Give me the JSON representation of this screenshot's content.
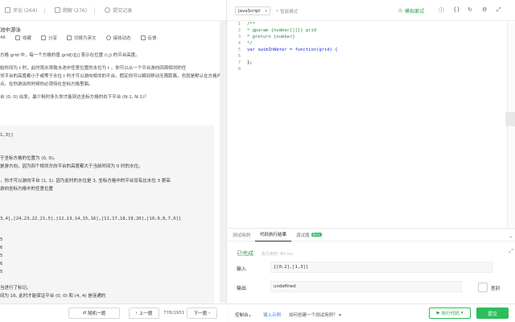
{
  "left": {
    "tabs": [
      {
        "label": "评论 (264)"
      },
      {
        "label": "题解 (276)"
      },
      {
        "label": "提交记录"
      }
    ],
    "title": "池中游泳",
    "actions": [
      {
        "label": "46"
      },
      {
        "label": "收藏"
      },
      {
        "label": "分享"
      },
      {
        "label": "切换为英文"
      },
      {
        "label": "接收动态"
      },
      {
        "label": "反馈"
      }
    ],
    "paragraphs": [
      "方格 grid 中，每一个方格的值 grid[i][j] 表示在位置 (i,j) 的平台高度。",
      "始时间为 t 时，此时雨水导致水池中任意位置的水位为 t 。你可以从一个平台游向四周相邻的任",
      "邻平台的高度都小于或等于水位 t 时才可以游向相邻的平台。假定你可以瞬间移动无限距离，也就是默认在方格内部游",
      "点。在你游泳的时候你必须待在坐标方格里面。",
      "台 (0, 0) 出发。最少耗时多久你才能到达坐标方格的右下平台 (N-1, N-1)？"
    ],
    "example1": [
      "1,3]]",
      "于坐标方格的位置为 (0, 0)。",
      "是游方向，因为四个相邻方向平台的高度都大于当前时间为 0 时的水位。",
      "，你才可以游向平台 (1, 1). 因为此时的水位是 3, 坐标方格中的平台没有比水位 3 更高",
      "游向坐标方格中的任意位置"
    ],
    "example2": [
      "3,4],[24,23,22,21,5],[12,13,14,15,16],[11,17,18,19,20],[10,9,8,7,6]]",
      "5",
      "6",
      "5",
      "6",
      "5",
      "当进行了标记。",
      "间为 16, 此时才能保证平台 (0, 0) 和 (4, 4) 是连通的"
    ],
    "bottom": {
      "random_label": "随机一题",
      "prev_label": "上一题",
      "page": "778/1951",
      "next_label": "下一题"
    }
  },
  "editor": {
    "language": "JavaScript",
    "smart_mode": "智能模式",
    "sim_test": "模拟面试",
    "line_numbers": [
      "1",
      "2",
      "3",
      "4",
      "5",
      "6",
      "7",
      "8"
    ],
    "lines": [
      {
        "text": "/**",
        "cls": "cm"
      },
      {
        "text": " * @param {number[][]} grid",
        "cls": "cm"
      },
      {
        "text": " * @return {number}",
        "cls": "cm"
      },
      {
        "text": " */",
        "cls": "cm"
      },
      {
        "text": "var swimInWater = function(grid) {",
        "cls": "kw"
      },
      {
        "text": "",
        "cls": "tx"
      },
      {
        "text": "};",
        "cls": "tx"
      },
      {
        "text": "",
        "cls": "tx"
      }
    ]
  },
  "result": {
    "tabs": [
      {
        "label": "测试用例"
      },
      {
        "label": "代码执行结果"
      },
      {
        "label": "调试器"
      }
    ],
    "debug_badge": "Beta",
    "status": "已完成",
    "time": "执行用时: 80 ms",
    "input_label": "输入",
    "input_value": "[[0,2],[1,3]]",
    "output_label": "输出",
    "output_value": "undefined",
    "diff_label": "差别"
  },
  "bottombar": {
    "console": "控制台",
    "example": "填入示例",
    "howto": "如何创建一个测试用例？",
    "run": "执行代码",
    "submit": "提交"
  }
}
